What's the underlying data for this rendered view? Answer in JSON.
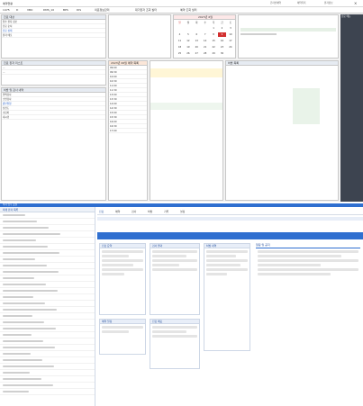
{
  "top_app": {
    "title": "예약현황",
    "status_items": [
      "온라인예약",
      "예약목록",
      "환자정보"
    ],
    "toolbar": [
      "1475",
      "D",
      "VBO",
      "DMS_10",
      "BPS",
      "DIS",
      "의료정보관리",
      "대기환자 조회 필터",
      "예약 조회 필터"
    ],
    "patient_panel": {
      "title": "진료 대상",
      "lines": [
        "접수 환자 정보",
        "진료 순서",
        "진료 상태",
        "환자 메모"
      ]
    },
    "left_panel1": {
      "title": "진료 환자 리스트"
    },
    "left_panel2": {
      "title": "처방 및 검사 내역",
      "rows": [
        "혈액검사",
        "소변검사",
        "흉부촬영",
        "심전도",
        "초음파",
        "내시경"
      ]
    },
    "center_panel": {
      "title": "2023년 06월 예약 목록",
      "timestamps": [
        "09:00",
        "09:30",
        "10:00",
        "10:30",
        "11:00",
        "11:30",
        "13:00",
        "13:30",
        "14:00",
        "14:30",
        "15:00",
        "15:30",
        "16:00",
        "16:30",
        "17:00"
      ]
    },
    "calendar": {
      "title": "2023년 6월",
      "weekdays": [
        "일",
        "월",
        "화",
        "수",
        "목",
        "금",
        "토"
      ],
      "days": [
        "",
        "",
        "",
        "",
        "1",
        "2",
        "3",
        "4",
        "5",
        "6",
        "7",
        "8",
        "9",
        "10",
        "11",
        "12",
        "13",
        "14",
        "15",
        "16",
        "17",
        "18",
        "19",
        "20",
        "21",
        "22",
        "23",
        "24",
        "25",
        "26",
        "27",
        "28",
        "29",
        "30",
        ""
      ]
    },
    "right_panel": {
      "title": "처방 목록"
    },
    "far_right": {
      "title": "진료 메뉴"
    }
  },
  "bottom_app": {
    "header": "의사 업무 포털",
    "tabs": [
      "진료",
      "예약",
      "검사",
      "처방",
      "기록",
      "설정"
    ],
    "left_list_title": "외래 환자 목록",
    "cards": [
      {
        "title": "진료 요약"
      },
      {
        "title": "검사 결과"
      },
      {
        "title": "처방 내역"
      },
      {
        "title": "예약 일정"
      },
      {
        "title": "진료 메모"
      }
    ],
    "right_title": "알림 및 공지"
  },
  "colors": {
    "accent": "#2f6fd0",
    "red": "#d23030",
    "dark": "#3d4450"
  }
}
